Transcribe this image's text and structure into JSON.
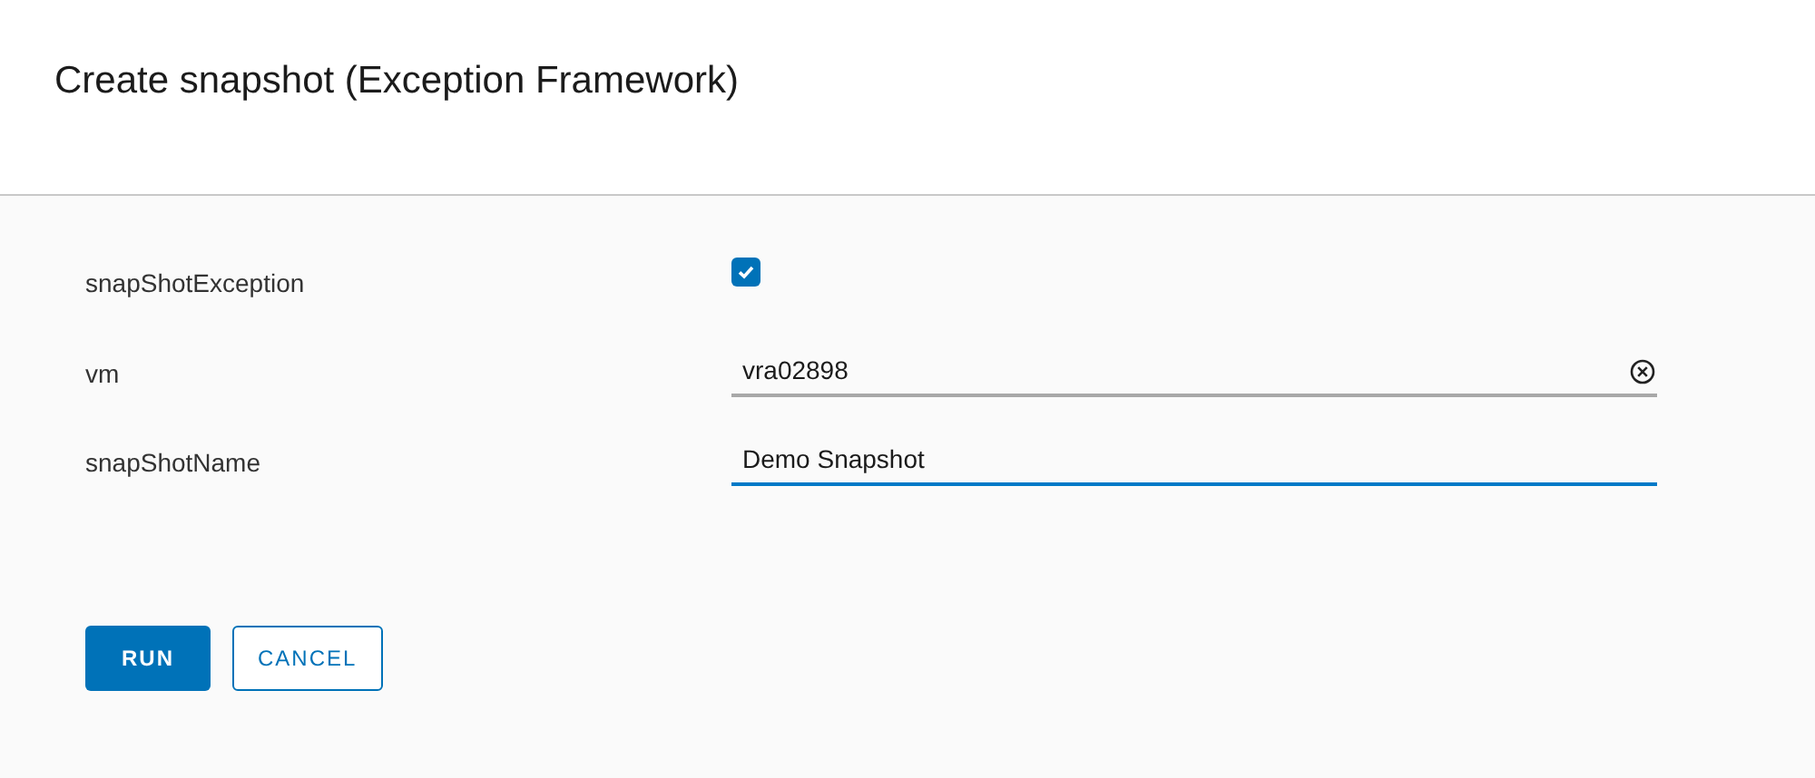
{
  "dialog": {
    "title": "Create snapshot (Exception Framework)"
  },
  "fields": [
    {
      "kind": "checkbox",
      "label": "snapShotException",
      "checked": true
    },
    {
      "kind": "text",
      "label": "vm",
      "value": "vra02898",
      "focused": false,
      "clearable": true
    },
    {
      "kind": "text",
      "label": "snapShotName",
      "value": "Demo Snapshot",
      "focused": true,
      "clearable": false
    }
  ],
  "buttons": [
    {
      "label": "RUN",
      "kind": "primary"
    },
    {
      "label": "CANCEL",
      "kind": "outline"
    }
  ]
}
